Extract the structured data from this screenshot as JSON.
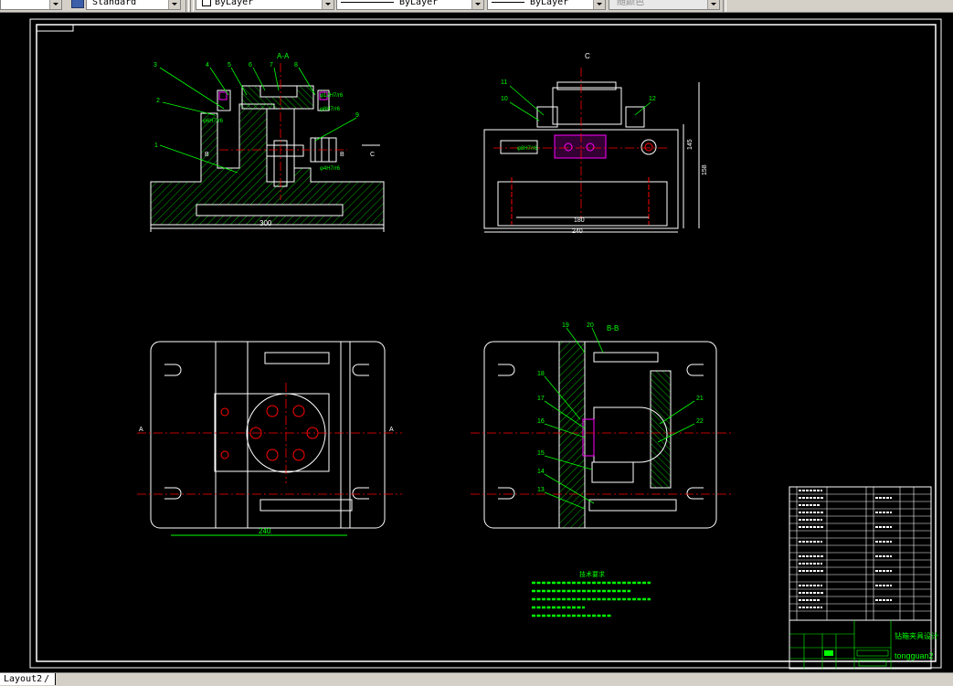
{
  "toolbar": {
    "text_style": "Standard",
    "layer_combo": "ByLayer",
    "linetype_combo": "ByLayer",
    "lineweight_combo": "ByLayer",
    "plotstyle_combo": "随颜色"
  },
  "colors": {
    "green": "#00ff00",
    "white": "#ffffff",
    "red": "#ff0000",
    "magenta": "#ff00ff",
    "cyan": "#00ffff",
    "yellow": "#ffff00"
  },
  "drawing": {
    "section_aa": "A-A",
    "section_bb": "B-B",
    "view_c": "C",
    "cut_a": "A",
    "cut_b": "B",
    "cut_c": "C",
    "dim_300": "300",
    "dim_240_top": "240",
    "dim_180": "180",
    "dim_158": "158",
    "dim_145": "145",
    "dim_240_plan": "240",
    "fit_1": "φ12H7/r6",
    "fit_2": "φ8H7/r6",
    "fit_3": "φ4H7/r6",
    "fit_4": "φ6H7/r6",
    "fit_5": "φ8H7/r6",
    "parts_aa": [
      "1",
      "2",
      "3",
      "4",
      "5",
      "6",
      "7",
      "8",
      "9"
    ],
    "parts_c": [
      "10",
      "11",
      "12"
    ],
    "parts_bb": [
      "13",
      "14",
      "15",
      "16",
      "17",
      "18",
      "19",
      "20",
      "21",
      "22"
    ],
    "tech_req_title": "技术要求",
    "title_block": {
      "drawing_name": "钻箱夹具设计",
      "drawing_no": "tongguan2"
    }
  },
  "tabs": {
    "layout2": "Layout2"
  }
}
